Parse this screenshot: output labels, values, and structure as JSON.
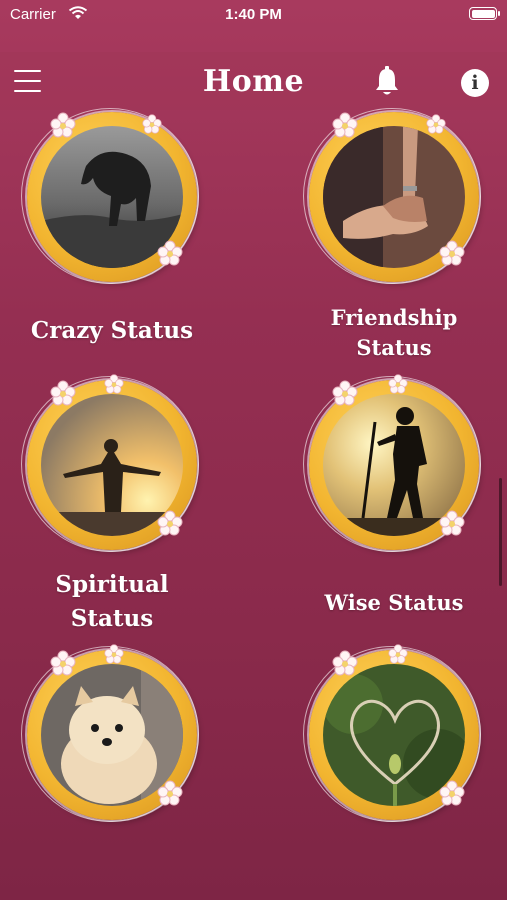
{
  "status_bar": {
    "carrier": "Carrier",
    "time": "1:40 PM"
  },
  "nav": {
    "title": "Home",
    "menu_icon": "hamburger-menu-icon",
    "bell_icon": "bell-icon",
    "info_label": "i"
  },
  "categories": [
    {
      "label": "Crazy Status",
      "image": "elephant-photo"
    },
    {
      "label_lines": [
        "Friendship",
        "Status"
      ],
      "image": "holding-hands-photo"
    },
    {
      "label_lines": [
        "Spiritual",
        "Status"
      ],
      "image": "sunrise-silhouette-photo"
    },
    {
      "label": "Wise Status",
      "image": "walking-elder-silhouette-photo"
    },
    {
      "label": "",
      "image": "pomeranian-dog-photo"
    },
    {
      "label": "",
      "image": "heart-plant-photo"
    }
  ],
  "colors": {
    "background": "#952f52",
    "frame_gold": "#f2b530"
  }
}
